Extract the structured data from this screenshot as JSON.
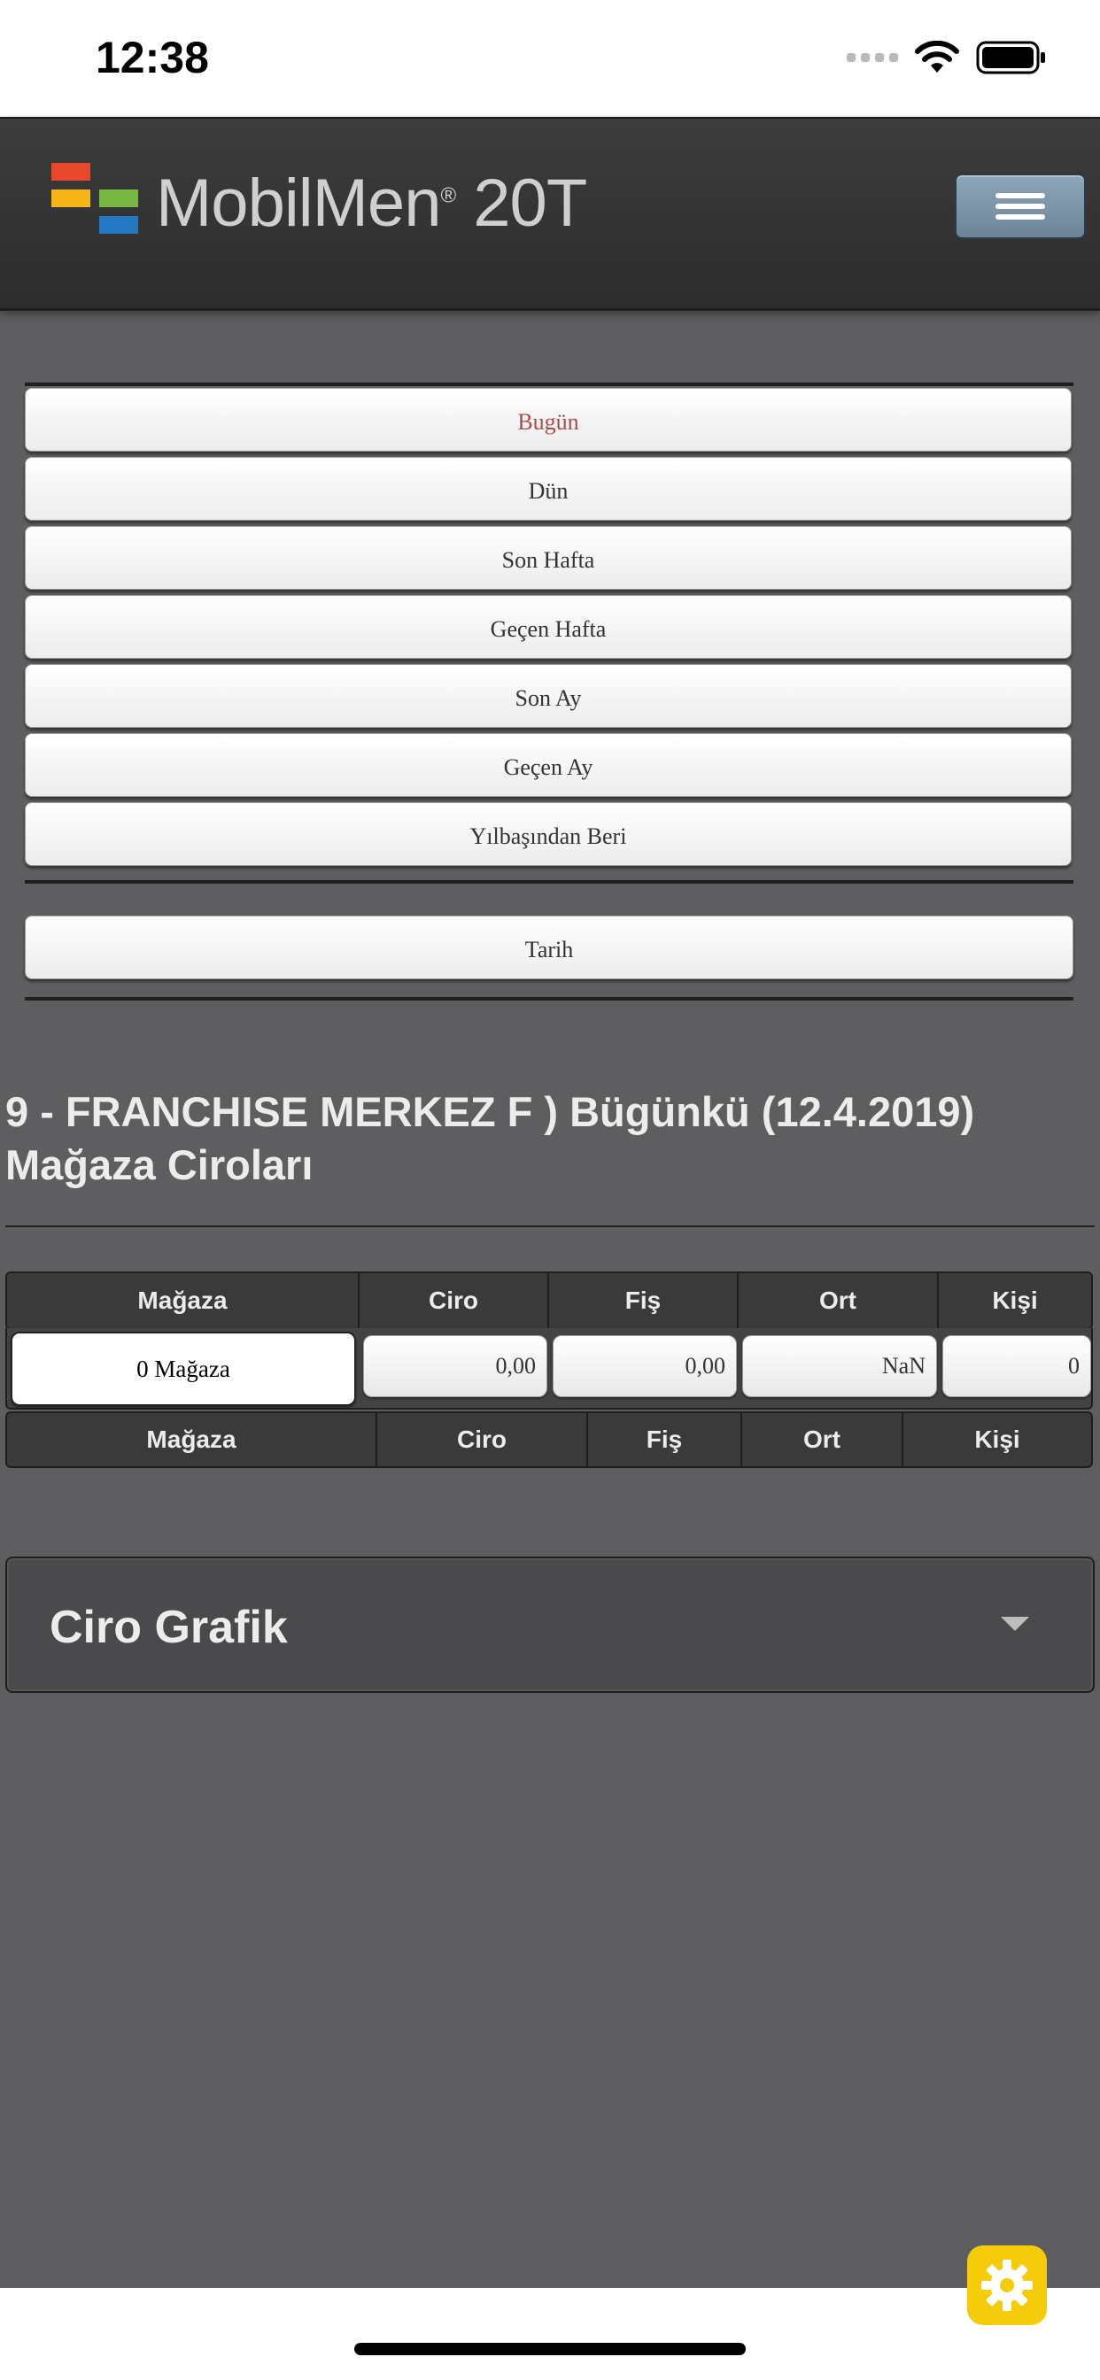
{
  "status_bar": {
    "time": "12:38"
  },
  "header": {
    "logo_text": "MobilMen",
    "logo_mark": "®",
    "logo_suffix": "20T",
    "menu_icon": "hamburger-icon"
  },
  "period_buttons": [
    {
      "label": "Bugün",
      "active": true
    },
    {
      "label": "Dün"
    },
    {
      "label": "Son Hafta"
    },
    {
      "label": "Geçen Hafta"
    },
    {
      "label": "Son Ay"
    },
    {
      "label": "Geçen Ay"
    },
    {
      "label": "Yılbaşından Beri"
    }
  ],
  "date_button": {
    "label": "Tarih"
  },
  "report": {
    "title_line1": "9 - FRANCHISE MERKEZ F ) Bügünkü (12.4.2019)",
    "title_line2": "Mağaza Ciroları"
  },
  "table": {
    "columns": [
      "Mağaza",
      "Ciro",
      "Fiş",
      "Ort",
      "Kişi"
    ],
    "row": {
      "store": "0 Mağaza",
      "ciro": "0,00",
      "fis": "0,00",
      "ort": "NaN",
      "kisi": "0"
    },
    "footer": [
      "Mağaza",
      "Ciro",
      "Fiş",
      "Ort",
      "Kişi"
    ]
  },
  "accordion": {
    "title": "Ciro Grafik"
  },
  "colors": {
    "accent_active": "#b04a4a",
    "fab": "#f5cc0a",
    "menu_button": "#7d95a7"
  }
}
